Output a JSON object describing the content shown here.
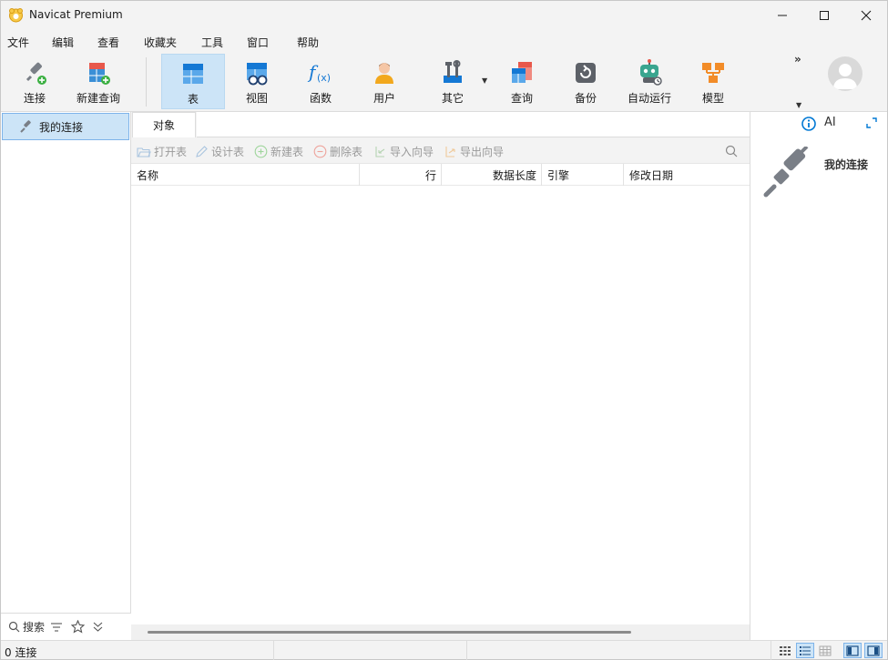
{
  "window": {
    "title": "Navicat Premium"
  },
  "menu": [
    "文件",
    "编辑",
    "查看",
    "收藏夹",
    "工具",
    "窗口",
    "帮助"
  ],
  "toolbar": {
    "connect": "连接",
    "new_query": "新建查询",
    "table": "表",
    "view": "视图",
    "function": "函数",
    "user": "用户",
    "other": "其它",
    "query": "查询",
    "backup": "备份",
    "automation": "自动运行",
    "model": "模型",
    "more": "»"
  },
  "sidebar": {
    "connection_label": "我的连接",
    "search_label": "搜索"
  },
  "tabs": {
    "objects": "对象"
  },
  "object_toolbar": {
    "open_table": "打开表",
    "design_table": "设计表",
    "new_table": "新建表",
    "delete_table": "删除表",
    "import_wizard": "导入向导",
    "export_wizard": "导出向导"
  },
  "columns": [
    "名称",
    "行",
    "数据长度",
    "引擎",
    "修改日期"
  ],
  "info_panel": {
    "ai_label": "AI",
    "title": "我的连接"
  },
  "status": {
    "text": "0 连接"
  },
  "colors": {
    "accent": "#0078d4",
    "selection": "#cce4f7",
    "chrome": "#f3f3f3"
  }
}
